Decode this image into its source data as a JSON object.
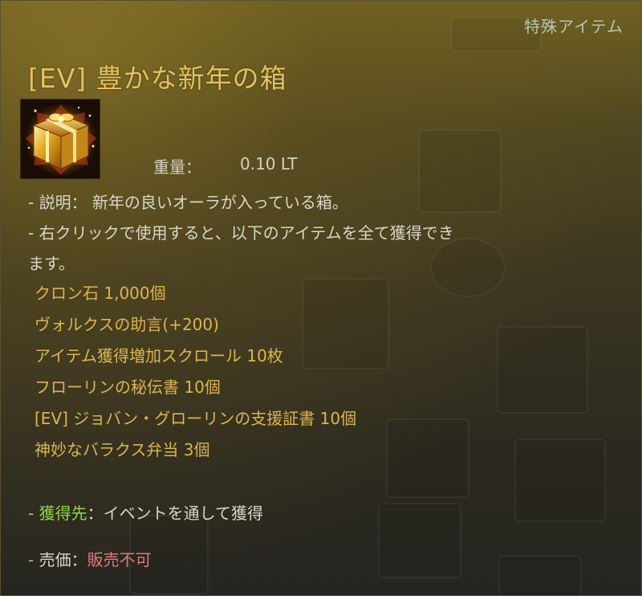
{
  "tooltip": {
    "category": "特殊アイテム",
    "title": "[EV] 豊かな新年の箱",
    "icon": "golden-gift-box-icon",
    "weight": {
      "label": "重量：",
      "value": "0.10 LT"
    },
    "description": {
      "line1": "- 説明： 新年の良いオーラが入っている箱。",
      "line2": "- 右クリックで使用すると、以下のアイテムを全て獲得でき",
      "line3": "ます。"
    },
    "items": [
      "クロン石 1,000個",
      "ヴォルクスの助言(+200)",
      "アイテム獲得増加スクロール 10枚",
      "フローリンの秘伝書 10個",
      "[EV] ジョバン・グローリンの支援証書 10個",
      "神妙なバラクス弁当 3個"
    ],
    "source": {
      "prefix": "- ",
      "label": "獲得先",
      "separator": "：",
      "value": "イベントを通して獲得"
    },
    "price": {
      "prefix": "- ",
      "label": "売価",
      "separator": "：",
      "value": "販売不可"
    },
    "colors": {
      "title": "#e4c25f",
      "items": "#ddb54e",
      "source_label": "#8ed64a",
      "price_value": "#e07a7a"
    }
  }
}
